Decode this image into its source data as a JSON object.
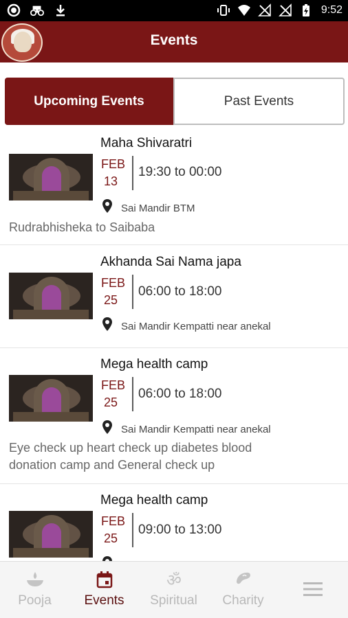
{
  "status_bar": {
    "time": "9:52",
    "left_icons": [
      "record-icon",
      "bike-icon",
      "download-icon"
    ],
    "right_icons": [
      "vibrate-icon",
      "wifi-icon",
      "signal-off-icon",
      "signal-off-icon",
      "battery-charging-icon"
    ]
  },
  "app_bar": {
    "title": "Events",
    "logo_icon": "sai-baba-logo"
  },
  "tabs": {
    "upcoming": "Upcoming Events",
    "past": "Past Events",
    "active": "upcoming"
  },
  "events": [
    {
      "title": "Maha Shivaratri",
      "month": "FEB",
      "day": "13",
      "time": "19:30  to  00:00",
      "location": "Sai Mandir BTM",
      "description": "Rudrabhisheka to Saibaba"
    },
    {
      "title": "Akhanda Sai Nama japa",
      "month": "FEB",
      "day": "25",
      "time": "06:00  to  18:00",
      "location": "Sai Mandir Kempatti near anekal",
      "description": ""
    },
    {
      "title": "Mega health camp",
      "month": "FEB",
      "day": "25",
      "time": "06:00  to  18:00",
      "location": "Sai Mandir Kempatti near anekal",
      "description_lines": [
        "Eye check up heart check up diabetes blood",
        "donation camp and General check up"
      ]
    },
    {
      "title": "Mega health camp",
      "month": "FEB",
      "day": "25",
      "time": "09:00  to  13:00",
      "location": "",
      "description": ""
    }
  ],
  "bottom_nav": {
    "items": [
      {
        "label": "Pooja",
        "icon": "diya-icon"
      },
      {
        "label": "Events",
        "icon": "calendar-icon"
      },
      {
        "label": "Spiritual",
        "icon": "om-icon"
      },
      {
        "label": "Charity",
        "icon": "charity-icon"
      },
      {
        "label": "",
        "icon": "menu-icon"
      }
    ],
    "active": "Events"
  },
  "colors": {
    "primary": "#7a1616",
    "inactive_nav": "#b8b8b8",
    "active_nav": "#5a0f0f"
  }
}
